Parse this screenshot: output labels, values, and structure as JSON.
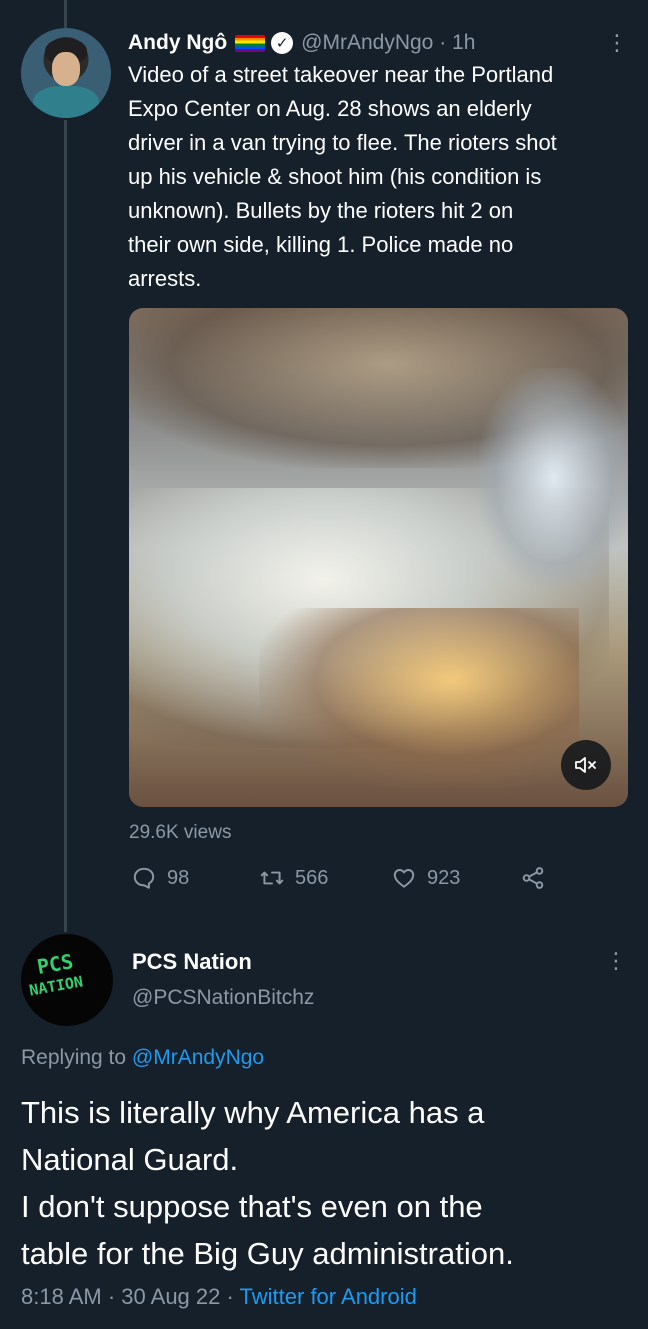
{
  "tweet1": {
    "name": "Andy Ngô",
    "handle": "@MrAndyNgo",
    "separator": " · ",
    "time": "1h",
    "text": "Video of a street takeover near the Portland\nExpo Center on Aug. 28 shows an elderly\ndriver in a van trying to flee. The rioters shot\nup his vehicle & shoot him (his condition is\nunknown). Bullets by the rioters hit 2 on\ntheir own side, killing 1. Police made no\narrests.",
    "views": "29.6K views",
    "replies": "98",
    "retweets": "566",
    "likes": "923",
    "icons": {
      "pride_flag": "rainbow-flag-icon",
      "verified": "verified-badge-icon",
      "more": "more-options-icon",
      "mute": "speaker-muted-icon",
      "reply": "reply-icon",
      "retweet": "retweet-icon",
      "like": "heart-icon",
      "share": "share-icon"
    }
  },
  "tweet2": {
    "name": "PCS Nation",
    "handle": "@PCSNationBitchz",
    "avatar_text_line1": "PCS",
    "avatar_text_line2": "NATION",
    "replying_prefix": "Replying to ",
    "replying_to": "@MrAndyNgo",
    "text": "This is literally why America has a\nNational Guard.\nI don't suppose that's even on the\ntable for the Big Guy administration.",
    "time": "8:18 AM",
    "date": "30 Aug 22",
    "source": "Twitter for Android",
    "separator": " · "
  },
  "colors": {
    "background": "#15202b",
    "secondary_text": "#8b98a5",
    "link": "#1d9bf0",
    "thread_line": "#38444d"
  }
}
